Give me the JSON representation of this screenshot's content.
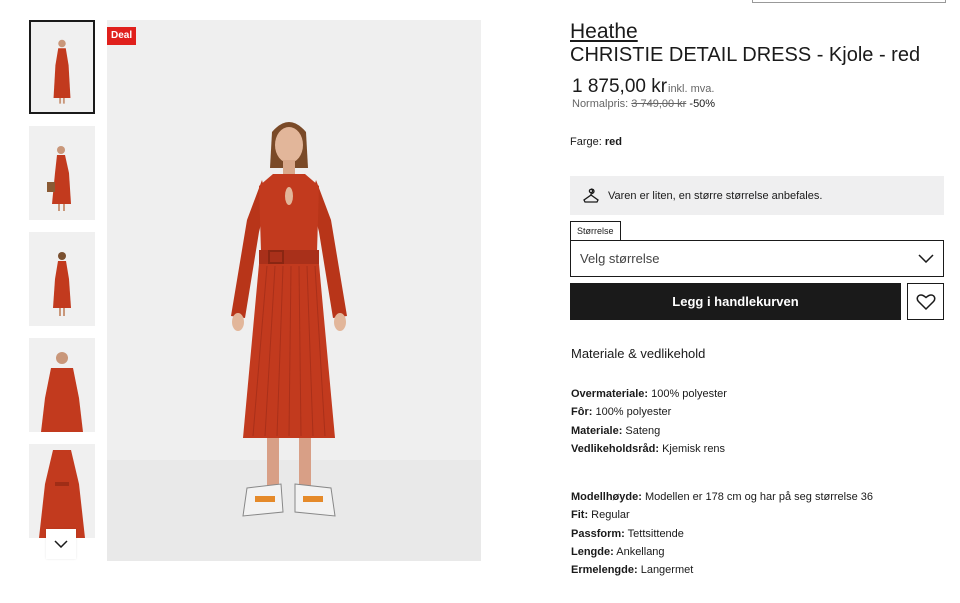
{
  "badge": "Deal",
  "product": {
    "brand": "Heathe",
    "title": "CHRISTIE DETAIL DRESS - Kjole - red",
    "price": "1 875,00 kr",
    "price_note": "inkl. mva.",
    "normal_label": "Normalpris:",
    "normal_price": "3 749,00 kr",
    "discount": "-50%",
    "color_label": "Farge:",
    "color_value": "red"
  },
  "size_hint": {
    "icon": "hanger-icon",
    "text": "Varen er liten, en større størrelse anbefales."
  },
  "size": {
    "label": "Størrelse",
    "placeholder": "Velg størrelse"
  },
  "actions": {
    "add_to_cart": "Legg i handlekurven",
    "wishlist_icon": "heart-icon"
  },
  "material": {
    "title": "Materiale & vedlikehold",
    "rows": [
      {
        "key": "Overmateriale:",
        "value": "100% polyester"
      },
      {
        "key": "Fôr:",
        "value": "100% polyester"
      },
      {
        "key": "Materiale:",
        "value": "Sateng"
      },
      {
        "key": "Vedlikeholdsråd:",
        "value": "Kjemisk rens"
      }
    ]
  },
  "fit": {
    "rows": [
      {
        "key": "Modellhøyde:",
        "value": "Modellen er 178 cm og har på seg størrelse 36"
      },
      {
        "key": "Fit:",
        "value": "Regular"
      },
      {
        "key": "Passform:",
        "value": "Tettsittende"
      },
      {
        "key": "Lengde:",
        "value": "Ankellang"
      },
      {
        "key": "Ermelengde:",
        "value": "Langermet"
      }
    ]
  },
  "colors": {
    "dress": "#c23a1e",
    "accent": "#e0201c",
    "text": "#1a1a1a"
  }
}
